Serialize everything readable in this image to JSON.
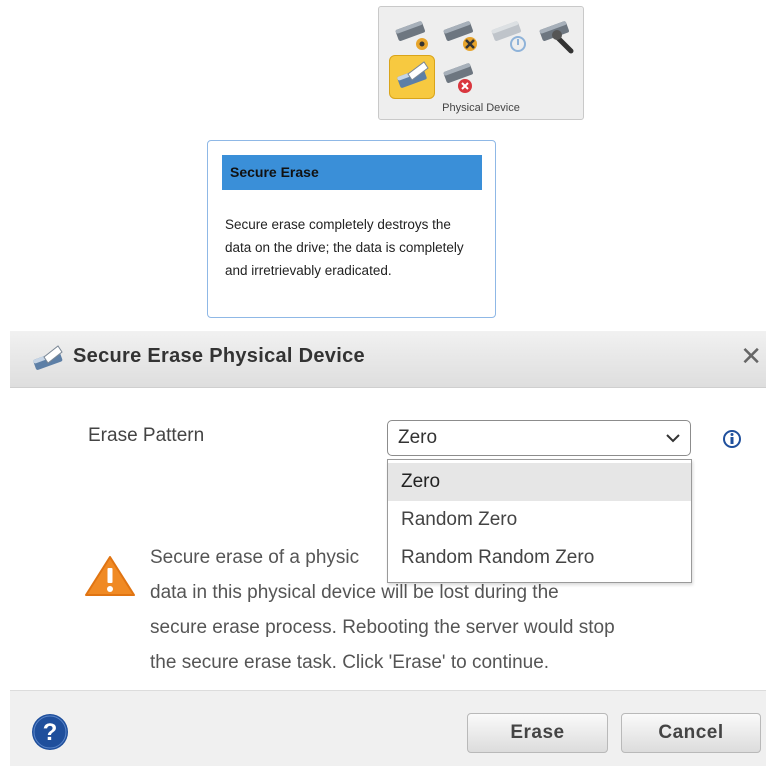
{
  "toolbar": {
    "caption": "Physical Device",
    "buttons": [
      {
        "icon": "drive-settings-icon"
      },
      {
        "icon": "drive-tools-icon"
      },
      {
        "icon": "drive-power-disabled-icon"
      },
      {
        "icon": "drive-wrench-icon"
      },
      {
        "icon": "secure-erase-icon",
        "selected": true
      },
      {
        "icon": "drive-remove-icon"
      }
    ]
  },
  "tooltip": {
    "title": "Secure Erase",
    "body": "Secure erase completely destroys the data on the drive; the data is completely and irretrievably eradicated."
  },
  "dialog": {
    "title": "Secure Erase Physical Device",
    "close_label": "✕",
    "field_label": "Erase Pattern",
    "select_value": "Zero",
    "options": [
      "Zero",
      "Random Zero",
      "Random Random Zero"
    ],
    "selected_option_index": 0,
    "warning_visible_lines": [
      "Secure erase of a physic",
      "data in this physical device will be lost during the",
      "secure erase process. Rebooting the server would stop",
      "the secure erase task. Click 'Erase' to continue."
    ],
    "buttons": {
      "erase": "Erase",
      "cancel": "Cancel"
    }
  },
  "colors": {
    "tooltip_header": "#3a8fd8",
    "selected_tool": "#f7c940",
    "warning": "#f08a24",
    "help": "#1f4f9c"
  }
}
